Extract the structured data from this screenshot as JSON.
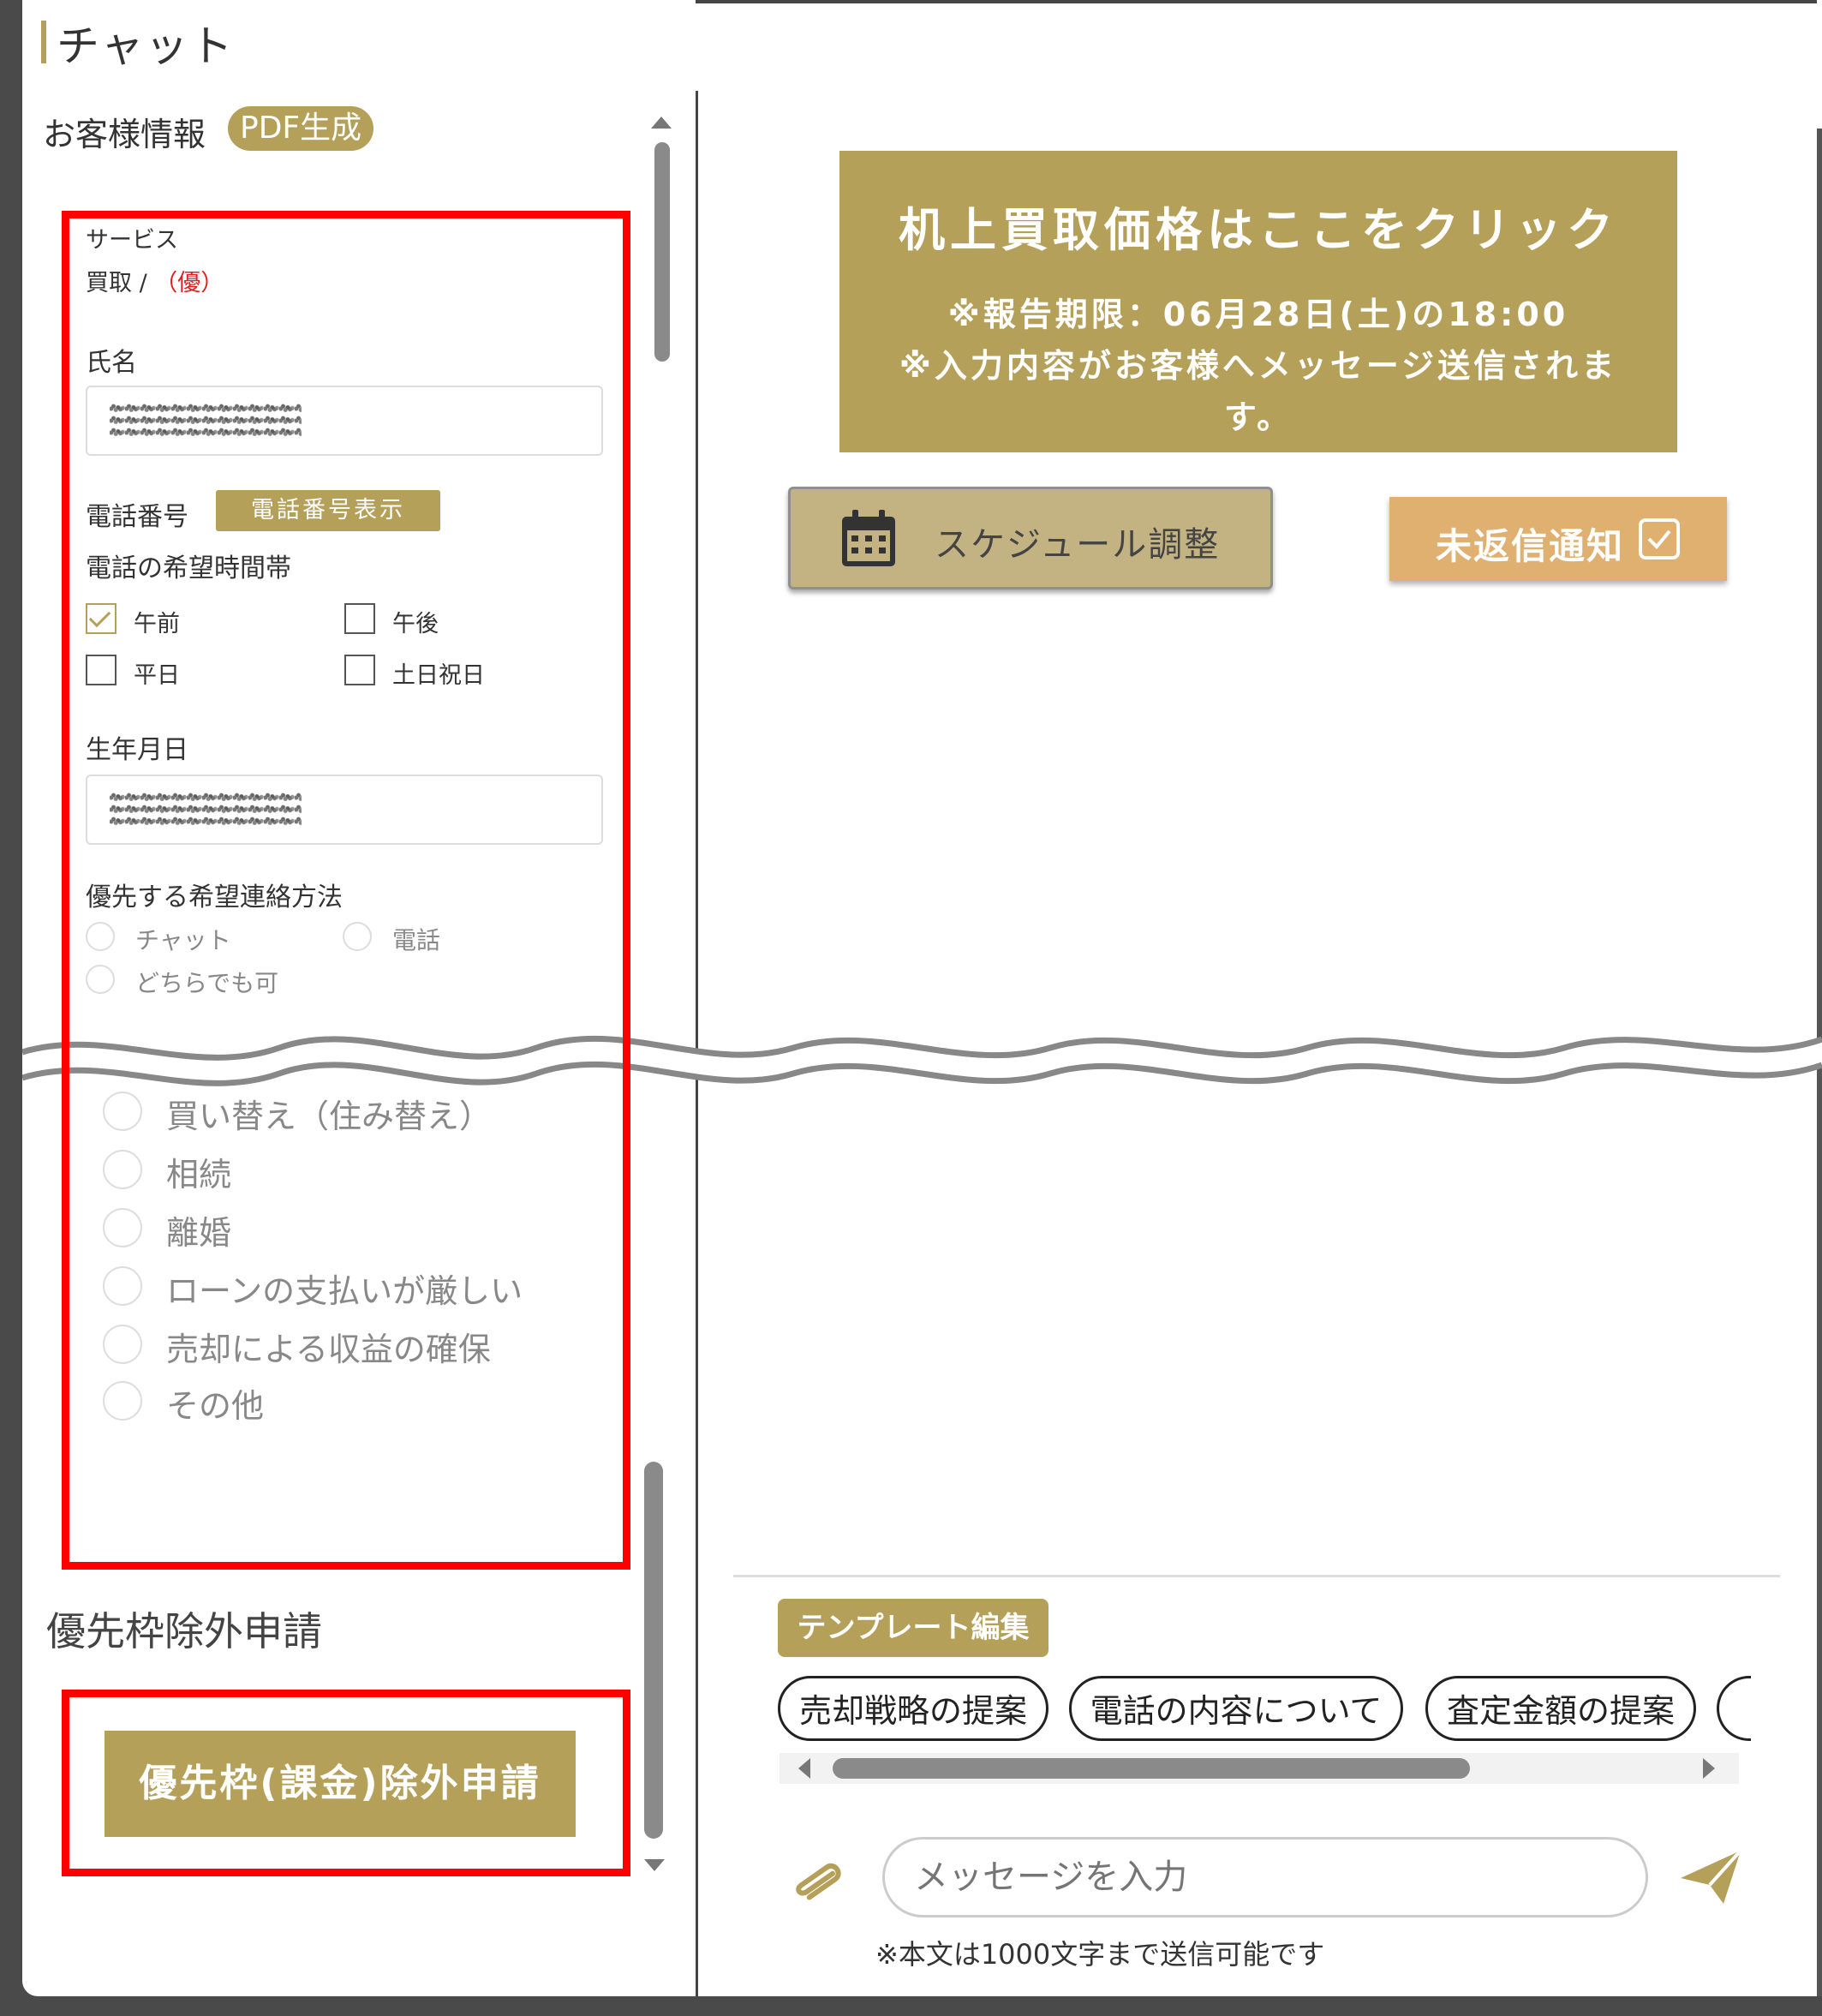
{
  "header": {
    "title": "チャット"
  },
  "customer": {
    "section_label": "お客様情報",
    "pdf_button": "PDF生成",
    "service_label": "サービス",
    "service_value": "買取 /",
    "service_tag": "（優）",
    "name_label": "氏名",
    "phone_label": "電話番号",
    "phone_button": "電話番号表示",
    "time_label": "電話の希望時間帯",
    "time_options": [
      {
        "label": "午前",
        "checked": true
      },
      {
        "label": "午後",
        "checked": false
      },
      {
        "label": "平日",
        "checked": false
      },
      {
        "label": "土日祝日",
        "checked": false
      }
    ],
    "birth_label": "生年月日",
    "contact_label": "優先する希望連絡方法",
    "contact_options": [
      "チャット",
      "電話",
      "どちらでも可"
    ],
    "reason_options": [
      "買い替え（住み替え）",
      "相続",
      "離婚",
      "ローンの支払いが厳しい",
      "売却による収益の確保",
      "その他"
    ]
  },
  "priority": {
    "title": "優先枠除外申請",
    "button": "優先枠(課金)除外申請"
  },
  "banner": {
    "heading": "机上買取価格はここをクリック",
    "line1": "※報告期限：06月28日(土)の18:00",
    "line2": "※入力内容がお客様へメッセージ送信されま",
    "line3": "す。"
  },
  "actions": {
    "schedule_button": "スケジュール調整",
    "notify_button": "未返信通知"
  },
  "templates": {
    "edit_button": "テンプレート編集",
    "chips": [
      "売却戦略の提案",
      "電話の内容について",
      "査定金額の提案"
    ]
  },
  "composer": {
    "placeholder": "メッセージを入力",
    "note": "※本文は1000文字まで送信可能です"
  },
  "colors": {
    "accent": "#b5a05a",
    "notify": "#e0b070",
    "highlight": "#ff0000"
  }
}
